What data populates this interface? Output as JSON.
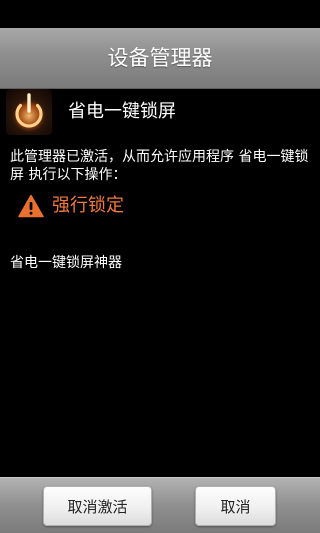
{
  "dialog": {
    "title": "设备管理器"
  },
  "app": {
    "name": "省电一键锁屏",
    "icon": "power-button-icon"
  },
  "description": "此管理器已激活，从而允许应用程序 省电一键锁屏 执行以下操作：",
  "policy": {
    "icon": "warning-icon",
    "label": "强行锁定",
    "color": "#f07a3c"
  },
  "footer_text": "省电一键锁屏神器",
  "buttons": {
    "deactivate_label": "取消激活",
    "cancel_label": "取消"
  }
}
